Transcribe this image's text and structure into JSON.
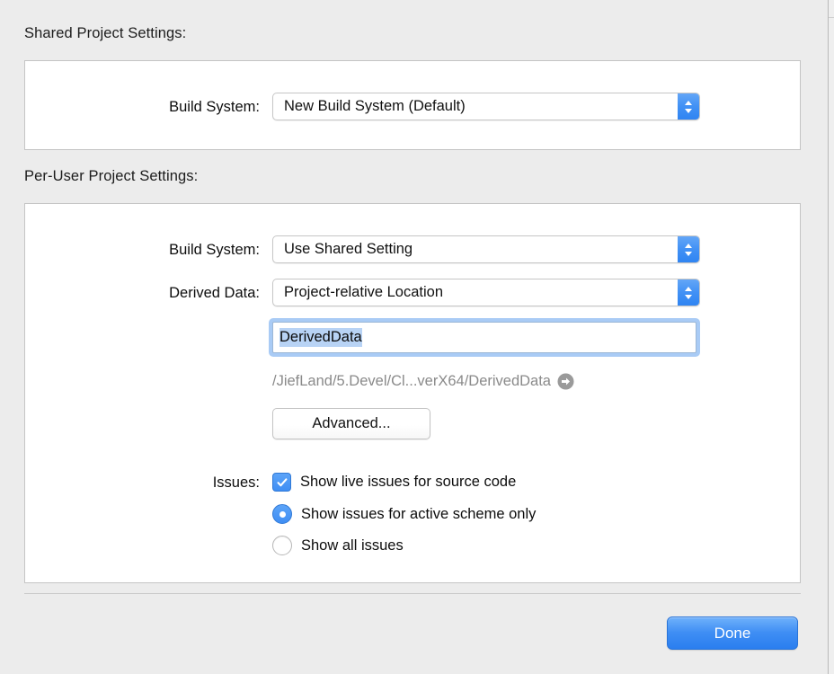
{
  "shared_section": {
    "title": "Shared Project Settings:",
    "build_system": {
      "label": "Build System:",
      "value": "New Build System (Default)",
      "stepper_icon": "chevron-up-down-icon"
    }
  },
  "per_user_section": {
    "title": "Per-User Project Settings:",
    "build_system": {
      "label": "Build System:",
      "value": "Use Shared Setting",
      "stepper_icon": "chevron-up-down-icon"
    },
    "derived_data": {
      "label": "Derived Data:",
      "value": "Project-relative Location",
      "stepper_icon": "chevron-up-down-icon",
      "path_field_value": "DerivedData",
      "resolved_path": "/JiefLand/5.Devel/Cl...verX64/DerivedData",
      "reveal_icon": "arrow-right-circle-icon",
      "advanced_label": "Advanced..."
    },
    "issues": {
      "label": "Issues:",
      "live_issues": {
        "label": "Show live issues for source code",
        "checked": true,
        "icon": "checkmark-icon"
      },
      "scope_options": [
        {
          "label": "Show issues for active scheme only",
          "selected": true
        },
        {
          "label": "Show all issues",
          "selected": false
        }
      ]
    }
  },
  "footer": {
    "done_label": "Done"
  },
  "colors": {
    "accent_blue": "#3f8ef4",
    "selection_blue": "#b8d3f5",
    "focus_ring_blue": "#a9cbf5",
    "window_background": "#ececec",
    "group_background": "#ffffff",
    "muted_text": "#8a8a8a"
  }
}
